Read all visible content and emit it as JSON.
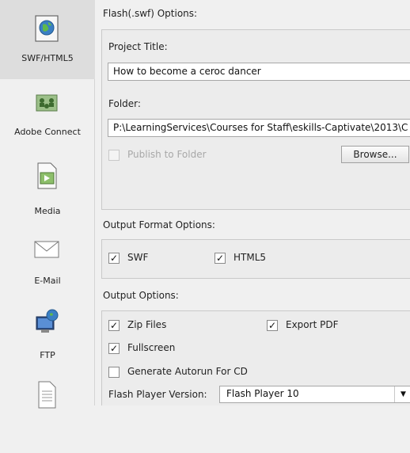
{
  "sidebar": {
    "items": [
      {
        "label": "SWF/HTML5",
        "icon": "globe-document-icon"
      },
      {
        "label": "Adobe Connect",
        "icon": "network-people-icon"
      },
      {
        "label": "Media",
        "icon": "media-file-icon"
      },
      {
        "label": "E-Mail",
        "icon": "envelope-icon"
      },
      {
        "label": "FTP",
        "icon": "ftp-computer-icon"
      },
      {
        "label": "",
        "icon": "document-icon"
      }
    ],
    "selected_index": 0
  },
  "flash_options": {
    "header": "Flash(.swf) Options:",
    "project_title_label": "Project Title:",
    "project_title_value": "How to become a ceroc dancer",
    "folder_label": "Folder:",
    "folder_value": "P:\\LearningServices\\Courses for Staff\\eskills-Captivate\\2013\\C",
    "publish_to_folder_label": "Publish to Folder",
    "publish_to_folder_checked": false,
    "browse_label": "Browse..."
  },
  "output_format": {
    "header": "Output Format Options:",
    "swf_label": "SWF",
    "swf_checked": true,
    "html5_label": "HTML5",
    "html5_checked": true
  },
  "output_options": {
    "header": "Output Options:",
    "zip_label": "Zip Files",
    "zip_checked": true,
    "export_pdf_label": "Export PDF",
    "export_pdf_checked": true,
    "fullscreen_label": "Fullscreen",
    "fullscreen_checked": true,
    "autorun_label": "Generate Autorun For CD",
    "autorun_checked": false,
    "flash_version_label": "Flash Player Version:",
    "flash_version_value": "Flash Player 10"
  },
  "colors": {
    "selected_bg": "#dddddd",
    "panel_bg": "#ececec",
    "border": "#c9c9c9"
  }
}
